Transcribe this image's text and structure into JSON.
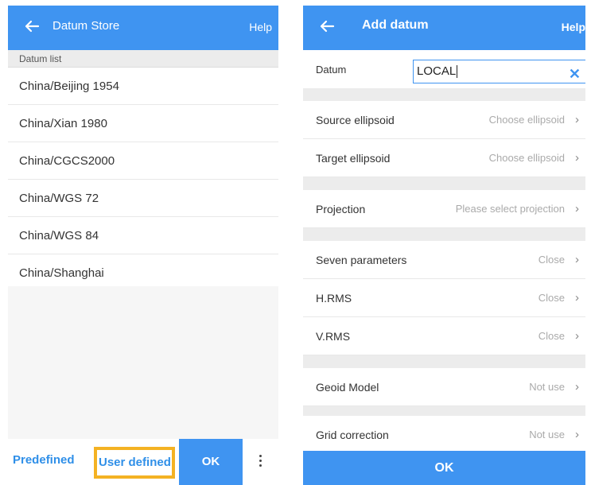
{
  "left": {
    "appbar": {
      "title": "Datum Store",
      "help": "Help"
    },
    "section_header": "Datum list",
    "datums": [
      "China/Beijing 1954",
      "China/Xian 1980",
      "China/CGCS2000",
      "China/WGS 72",
      "China/WGS 84",
      "China/Shanghai"
    ],
    "bottom": {
      "predefined": "Predefined",
      "user_defined": "User defined",
      "ok": "OK"
    }
  },
  "right": {
    "appbar": {
      "title": "Add datum",
      "help": "Help"
    },
    "datum": {
      "label": "Datum",
      "value": "LOCAL"
    },
    "rows": {
      "source_ellipsoid": {
        "label": "Source ellipsoid",
        "value": "Choose ellipsoid"
      },
      "target_ellipsoid": {
        "label": "Target ellipsoid",
        "value": "Choose ellipsoid"
      },
      "projection": {
        "label": "Projection",
        "value": "Please select projection"
      },
      "seven_parameters": {
        "label": "Seven parameters",
        "value": "Close"
      },
      "h_rms": {
        "label": "H.RMS",
        "value": "Close"
      },
      "v_rms": {
        "label": "V.RMS",
        "value": "Close"
      },
      "geoid_model": {
        "label": "Geoid Model",
        "value": "Not use"
      },
      "grid_correction": {
        "label": "Grid correction",
        "value": "Not use"
      }
    },
    "ok": "OK"
  },
  "icons": {
    "back": "arrow-left-icon",
    "chevron": "chevron-right-icon",
    "clear": "close-icon",
    "more": "more-vertical-icon"
  },
  "colors": {
    "primary": "#3f94f1",
    "highlight": "#f4b223"
  }
}
